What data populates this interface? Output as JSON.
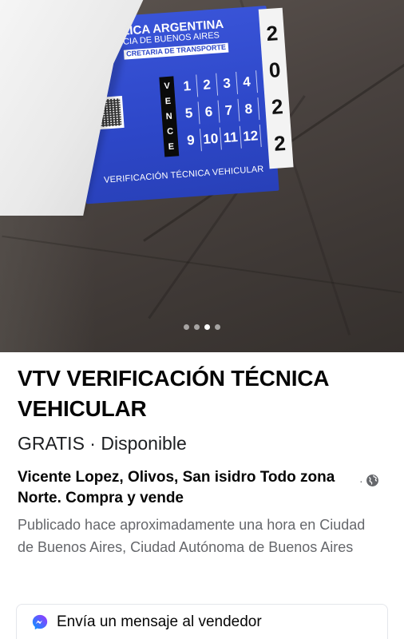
{
  "photo": {
    "sticker": {
      "header_line1": "LICA ARGENTINA",
      "header_line2": "CIA DE BUENOS AIRES",
      "header_line3": "CRETARIA DE TRANSPORTE",
      "vence_letters": [
        "V",
        "E",
        "N",
        "C",
        "E"
      ],
      "months": [
        "1",
        "2",
        "3",
        "4",
        "5",
        "6",
        "7",
        "8",
        "9",
        "10",
        "11",
        "12"
      ],
      "year_digits": [
        "2",
        "0",
        "2",
        "2"
      ],
      "footer": "VERIFICACIÓN TÉCNICA VEHICULAR"
    },
    "carousel": {
      "total": 4,
      "active_index": 2
    }
  },
  "listing": {
    "title": "VTV VERIFICACIÓN TÉCNICA VEHICULAR",
    "price_status": "GRATIS · Disponible",
    "location": "Vicente Lopez, Olivos, San isidro Todo zona Norte.  Compra y vende",
    "published": "Publicado hace aproximadamente una hora en Ciudad de Buenos Aires, Ciudad Autónoma de Buenos Aires"
  },
  "actions": {
    "message_seller": "Envía un mensaje al vendedor"
  },
  "icons": {
    "globe": "globe-icon",
    "messenger": "messenger-icon"
  },
  "colors": {
    "messenger_gradient_start": "#0099ff",
    "messenger_gradient_end": "#a033ff",
    "secondary_text": "#65676b"
  }
}
